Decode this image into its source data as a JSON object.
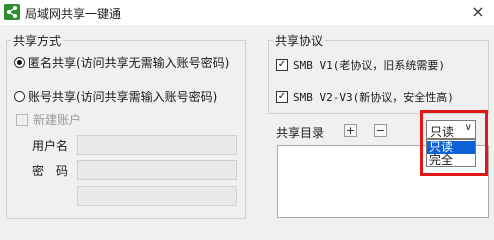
{
  "window": {
    "title": "局域网共享一键通",
    "close_glyph": "×"
  },
  "share_mode": {
    "legend": "共享方式",
    "anon_label": "匿名共享(访问共享无需输入账号密码)",
    "account_label": "账号共享(访问共享需输入账号密码)",
    "new_account_label": "新建账户",
    "username_label": "用户名",
    "password_label": "密　码"
  },
  "protocol": {
    "legend": "共享协议",
    "smb1_label": "SMB V1(老协议，旧系统需要)",
    "smb2_label": "SMB V2-V3(新协议，安全性高)"
  },
  "directory": {
    "label": "共享目录",
    "add_glyph": "+",
    "remove_glyph": "−",
    "permission": {
      "selected": "只读",
      "arrow": "∨",
      "options": [
        "只读",
        "完全"
      ]
    }
  },
  "colors": {
    "highlight_box": "#e01818",
    "selection": "#0a62d6",
    "app_icon": "#2f8f2f"
  }
}
